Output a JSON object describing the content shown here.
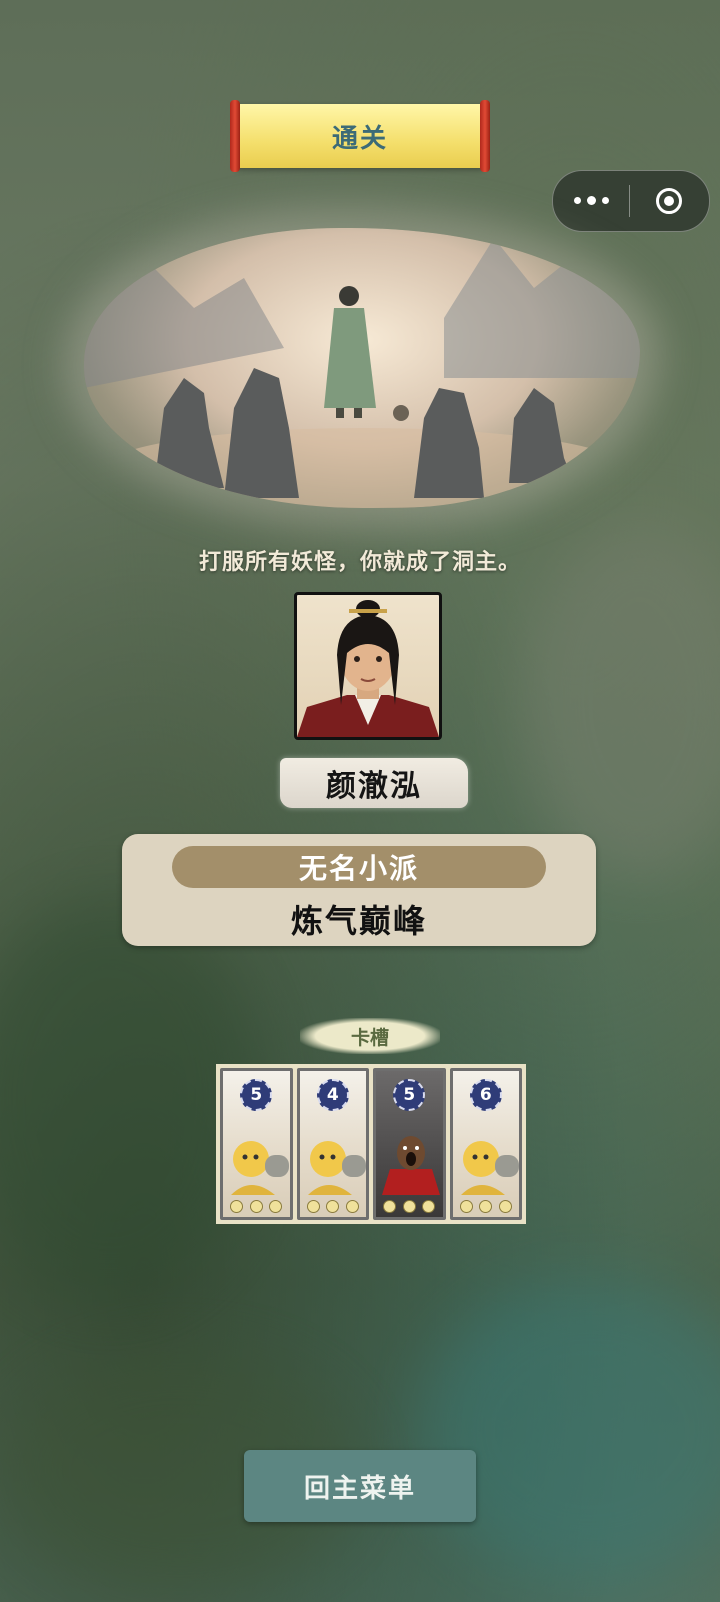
{
  "header": {
    "title": "通关"
  },
  "capsule": {
    "more_icon": "more-dots-icon",
    "close_icon": "target-circle-icon"
  },
  "scene": {
    "subtitle": "打服所有妖怪，你就成了洞主。"
  },
  "character": {
    "name": "颜澈泓"
  },
  "status": {
    "sect": "无名小派",
    "realm": "炼气巅峰"
  },
  "card_slots": {
    "label": "卡槽",
    "cards": [
      {
        "cost": "5",
        "art": "yellow-monk-icon",
        "style": "light"
      },
      {
        "cost": "4",
        "art": "yellow-monk-icon",
        "style": "light"
      },
      {
        "cost": "5",
        "art": "red-robed-monk-icon",
        "style": "dark"
      },
      {
        "cost": "6",
        "art": "yellow-monk-icon",
        "style": "light"
      }
    ]
  },
  "footer": {
    "main_menu_label": "回主菜单"
  },
  "colors": {
    "accent_button": "#5c8682",
    "title_text": "#3c6b77",
    "cost_badge": "#2f3c78",
    "sect_pill": "#a38f6a"
  }
}
